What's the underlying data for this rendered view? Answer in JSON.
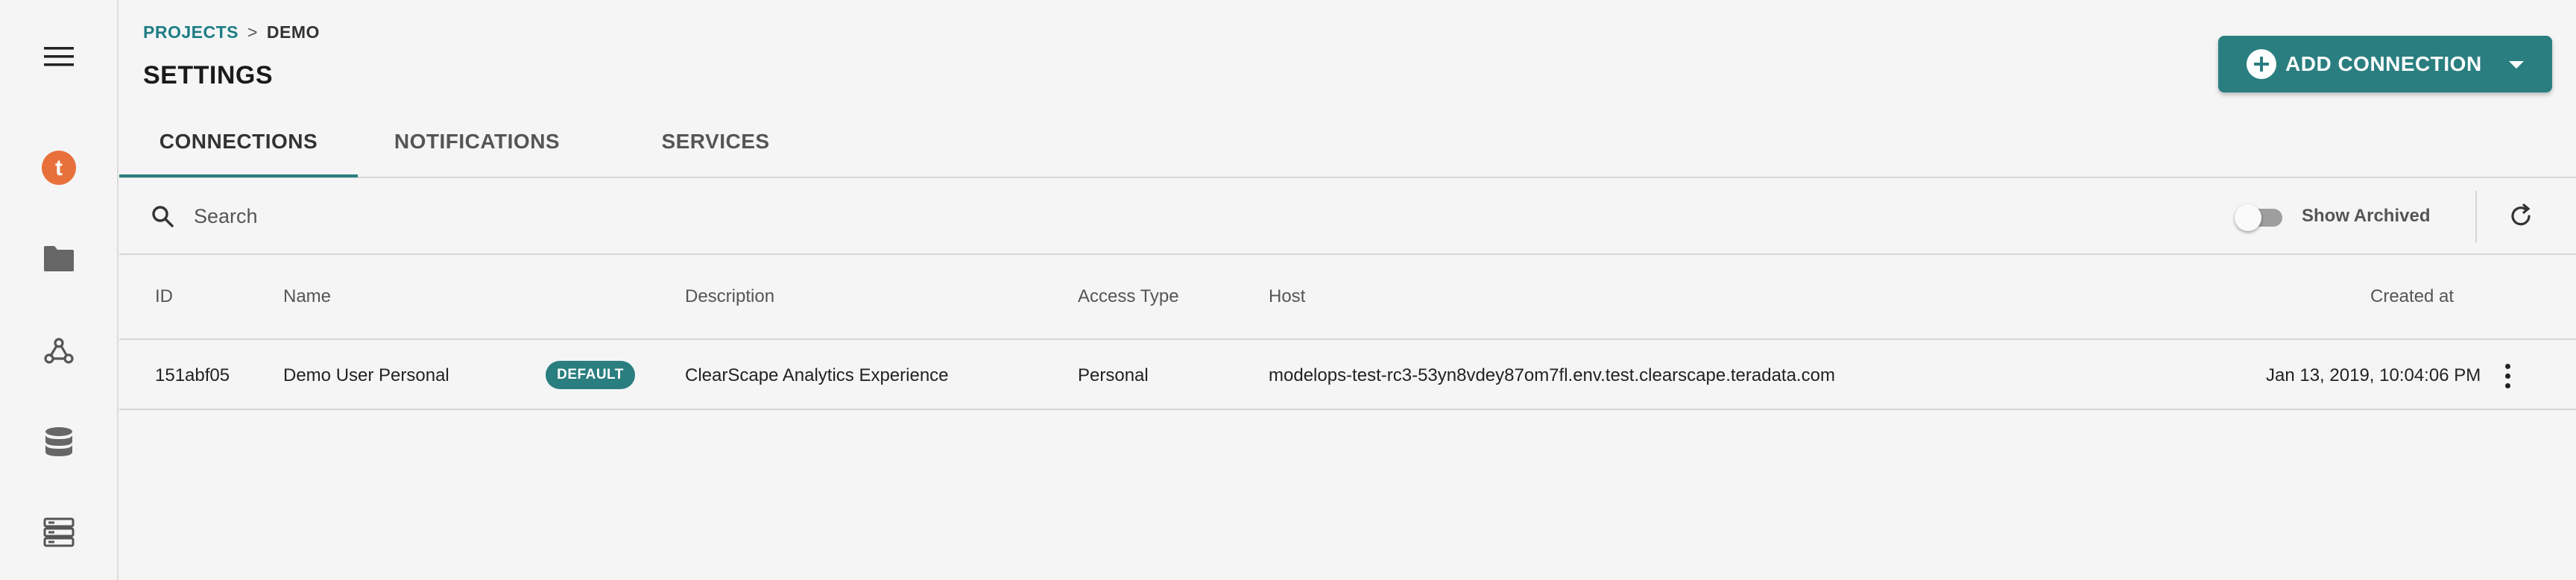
{
  "sidebar": {
    "icons": [
      {
        "name": "menu-icon"
      },
      {
        "name": "teradata-logo-icon",
        "letter": "t",
        "color": "#e8703a"
      },
      {
        "name": "folder-icon"
      },
      {
        "name": "webhook-icon"
      },
      {
        "name": "database-icon"
      },
      {
        "name": "server-icon"
      }
    ]
  },
  "breadcrumb": {
    "items": [
      "PROJECTS",
      "DEMO"
    ],
    "separator": ">"
  },
  "page": {
    "title": "SETTINGS"
  },
  "actions": {
    "add_connection_label": "ADD CONNECTION",
    "add_connection_color": "#2a7e80"
  },
  "tabs": [
    {
      "label": "CONNECTIONS",
      "active": true
    },
    {
      "label": "NOTIFICATIONS",
      "active": false
    },
    {
      "label": "SERVICES",
      "active": false
    }
  ],
  "toolbar": {
    "search_placeholder": "Search",
    "show_archived_label": "Show Archived",
    "show_archived_on": false
  },
  "table": {
    "columns": [
      "ID",
      "Name",
      "Description",
      "Access Type",
      "Host",
      "Created at"
    ],
    "rows": [
      {
        "id": "151abf05",
        "name": "Demo User Personal",
        "badge": "DEFAULT",
        "description": "ClearScape Analytics Experience",
        "access_type": "Personal",
        "host": "modelops-test-rc3-53yn8vdey87om7fl.env.test.clearscape.teradata.com",
        "created_at": "Jan 13, 2019, 10:04:06 PM"
      }
    ]
  }
}
